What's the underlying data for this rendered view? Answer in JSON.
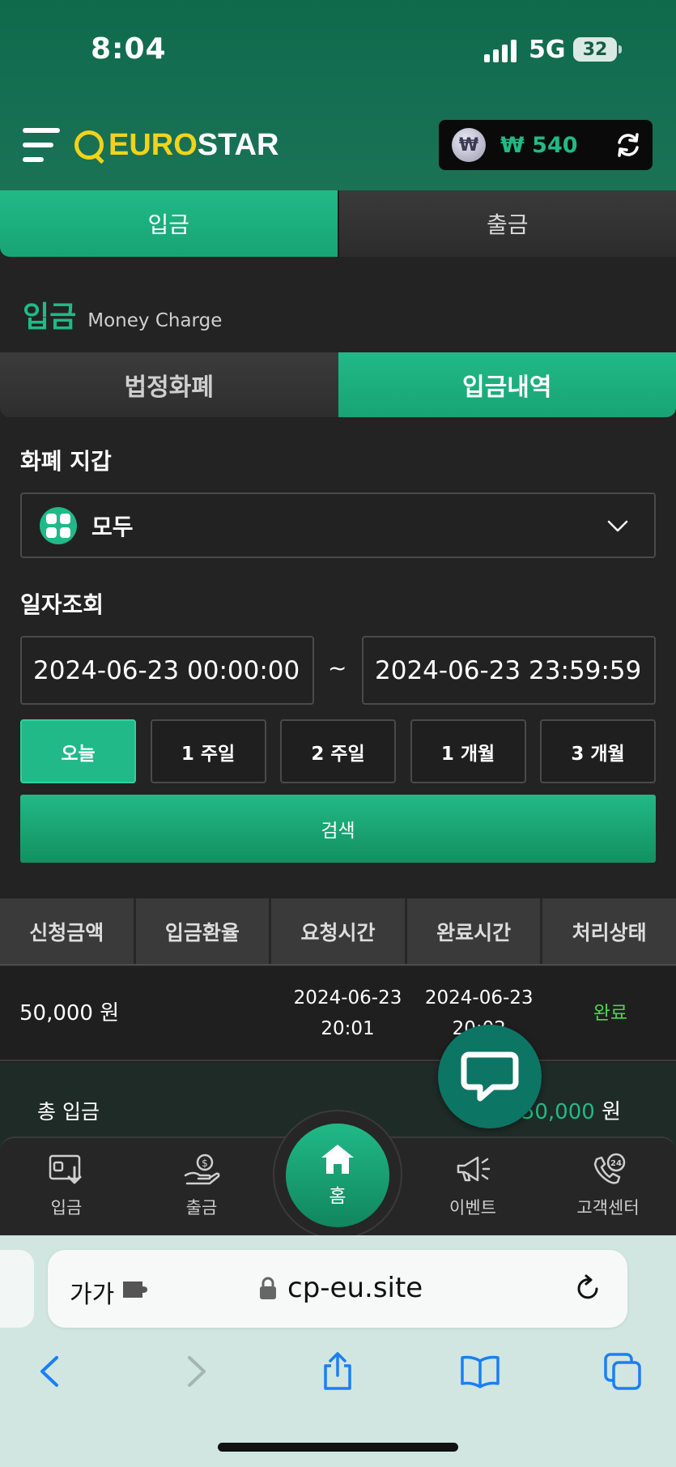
{
  "status_bar": {
    "time": "8:04",
    "network": "5G",
    "battery": "32"
  },
  "header": {
    "logo_euro": "EURO",
    "logo_star": "STAR",
    "wallet_currency_symbol": "₩",
    "wallet_balance": "₩ 540"
  },
  "main_tabs": [
    {
      "label": "입금",
      "active": true
    },
    {
      "label": "출금",
      "active": false
    }
  ],
  "section": {
    "title_ko": "입금",
    "title_en": "Money Charge"
  },
  "sub_tabs": [
    {
      "label": "법정화폐",
      "active": false
    },
    {
      "label": "입금내역",
      "active": true
    }
  ],
  "form": {
    "wallet_label": "화폐 지갑",
    "wallet_selected": "모두",
    "date_label": "일자조회",
    "date_from": "2024-06-23 00:00:00",
    "date_to": "2024-06-23 23:59:59",
    "date_separator": "~",
    "periods": [
      "오늘",
      "1 주일",
      "2 주일",
      "1 개월",
      "3 개월"
    ],
    "active_period": "오늘",
    "search_label": "검색"
  },
  "table": {
    "headers": [
      "신청금액",
      "입금환율",
      "요청시간",
      "완료시간",
      "처리상태"
    ],
    "rows": [
      {
        "amount": "50,000 원",
        "rate": "",
        "requested": "2024-06-23\n20:01",
        "completed": "2024-06-23\n20:02",
        "status": "완료"
      }
    ]
  },
  "total": {
    "label": "총 입금",
    "value": "50,000",
    "unit": "원"
  },
  "bottom_nav": [
    {
      "label": "입금",
      "icon": "deposit-icon"
    },
    {
      "label": "출금",
      "icon": "withdraw-icon"
    },
    {
      "label": "홈",
      "icon": "home-icon"
    },
    {
      "label": "이벤트",
      "icon": "megaphone-icon"
    },
    {
      "label": "고객센터",
      "icon": "support-24-icon"
    }
  ],
  "browser": {
    "aa_label": "가가",
    "url": "cp-eu.site"
  },
  "colors": {
    "accent": "#21b987",
    "header_green": "#166f52",
    "status_done": "#52d24f",
    "logo_yellow": "#f2d21b"
  }
}
